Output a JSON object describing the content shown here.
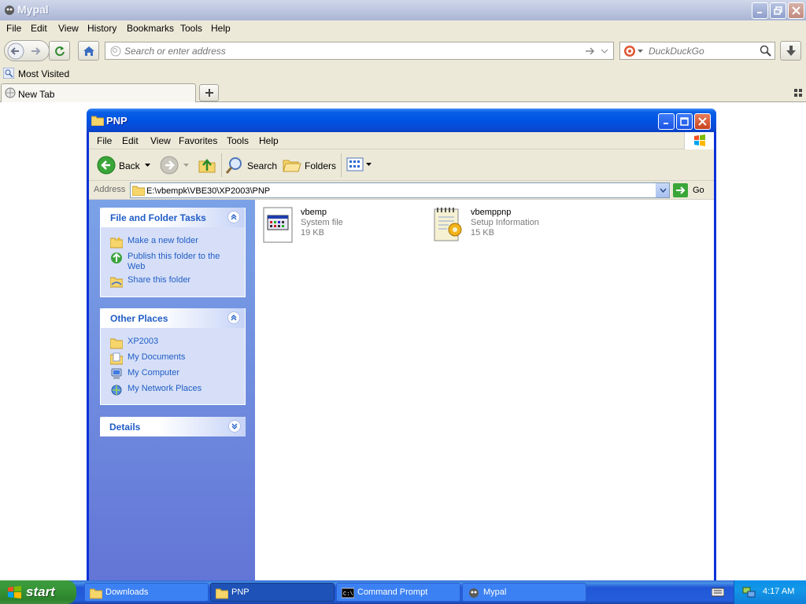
{
  "browser": {
    "title": "Mypal",
    "menu": [
      "File",
      "Edit",
      "View",
      "History",
      "Bookmarks",
      "Tools",
      "Help"
    ],
    "url_placeholder": "Search or enter address",
    "search_placeholder": "DuckDuckGo",
    "bookmark": "Most Visited",
    "tab_label": "New Tab"
  },
  "explorer": {
    "title": "PNP",
    "menu": [
      "File",
      "Edit",
      "View",
      "Favorites",
      "Tools",
      "Help"
    ],
    "toolbar": {
      "back": "Back",
      "search": "Search",
      "folders": "Folders"
    },
    "address_label": "Address",
    "address_value": "E:\\vbempk\\VBE30\\XP2003\\PNP",
    "go_label": "Go",
    "panels": {
      "tasks": {
        "title": "File and Folder Tasks",
        "items": [
          "Make a new folder",
          "Publish this folder to the Web",
          "Share this folder"
        ]
      },
      "places": {
        "title": "Other Places",
        "items": [
          "XP2003",
          "My Documents",
          "My Computer",
          "My Network Places"
        ]
      },
      "details": {
        "title": "Details"
      }
    },
    "files": [
      {
        "name": "vbemp",
        "type": "System file",
        "size": "19 KB"
      },
      {
        "name": "vbemppnp",
        "type": "Setup Information",
        "size": "15 KB"
      }
    ]
  },
  "taskbar": {
    "start": "start",
    "buttons": [
      "Downloads",
      "PNP",
      "Command Prompt",
      "Mypal"
    ],
    "clock": "4:17 AM"
  },
  "colors": {
    "xp_blue": "#0054e3",
    "taskbar_blue": "#245edb",
    "start_green": "#389838",
    "link_blue": "#215dc6"
  }
}
